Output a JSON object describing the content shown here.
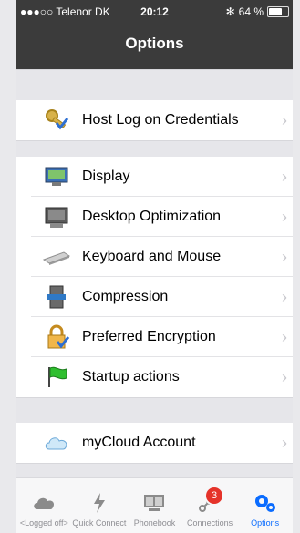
{
  "status_bar": {
    "carrier": "●●●○○ Telenor DK",
    "time": "20:12",
    "battery": "64 %",
    "battery_level_percent": 64
  },
  "navbar": {
    "title": "Options"
  },
  "rows": [
    {
      "label": "Host Log on Credentials",
      "icon": "keys-icon"
    },
    {
      "label": "Display",
      "icon": "monitor-icon"
    },
    {
      "label": "Desktop Optimization",
      "icon": "desktop-optimization-icon"
    },
    {
      "label": "Keyboard and Mouse",
      "icon": "keyboard-icon"
    },
    {
      "label": "Compression",
      "icon": "compression-icon"
    },
    {
      "label": "Preferred Encryption",
      "icon": "lock-icon"
    },
    {
      "label": "Startup actions",
      "icon": "flag-icon"
    },
    {
      "label": "myCloud Account",
      "icon": "cloud-icon"
    }
  ],
  "tabs": [
    {
      "label": "<Logged off>",
      "icon": "cloud-icon"
    },
    {
      "label": "Quick Connect",
      "icon": "lightning-icon"
    },
    {
      "label": "Phonebook",
      "icon": "phonebook-icon"
    },
    {
      "label": "Connections",
      "icon": "connections-icon",
      "badge": "3"
    },
    {
      "label": "Options",
      "icon": "gears-icon",
      "active": true
    }
  ],
  "colors": {
    "navbar": "#3b3b3b",
    "active_tab": "#0a6cff",
    "badge": "#e5332a",
    "flag": "#2fbf2f"
  }
}
